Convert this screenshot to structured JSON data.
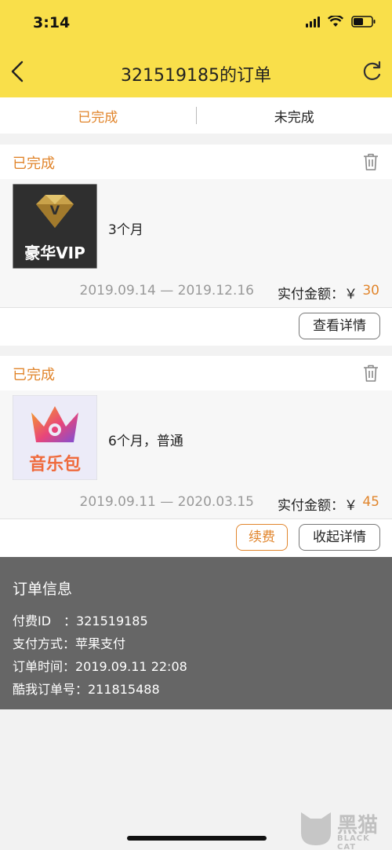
{
  "status_bar": {
    "time": "3:14"
  },
  "nav": {
    "title": "321519185的订单"
  },
  "tabs": [
    {
      "label": "已完成",
      "active": true
    },
    {
      "label": "未完成",
      "active": false
    }
  ],
  "orders": [
    {
      "status": "已完成",
      "product": "3个月",
      "thumb_text": "豪华VIP",
      "dates": "2019.09.14 — 2019.12.16",
      "price_label": "实付金额：￥",
      "price": "30",
      "buttons": [
        "查看详情"
      ]
    },
    {
      "status": "已完成",
      "product": "6个月，普通",
      "thumb_text": "音乐包",
      "dates": "2019.09.11 — 2020.03.15",
      "price_label": "实付金额：￥",
      "price": "45",
      "buttons": [
        "续费",
        "收起详情"
      ]
    }
  ],
  "order_info": {
    "title": "订单信息",
    "lines": [
      "付费ID　：321519185",
      "支付方式：苹果支付",
      "订单时间：2019.09.11 22:08",
      "酷我订单号：211815488"
    ]
  },
  "watermark": {
    "cn": "黑猫",
    "en": "BLACK CAT"
  },
  "colors": {
    "header": "#f9df4a",
    "accent": "#e1852c",
    "info_panel": "#666666"
  }
}
